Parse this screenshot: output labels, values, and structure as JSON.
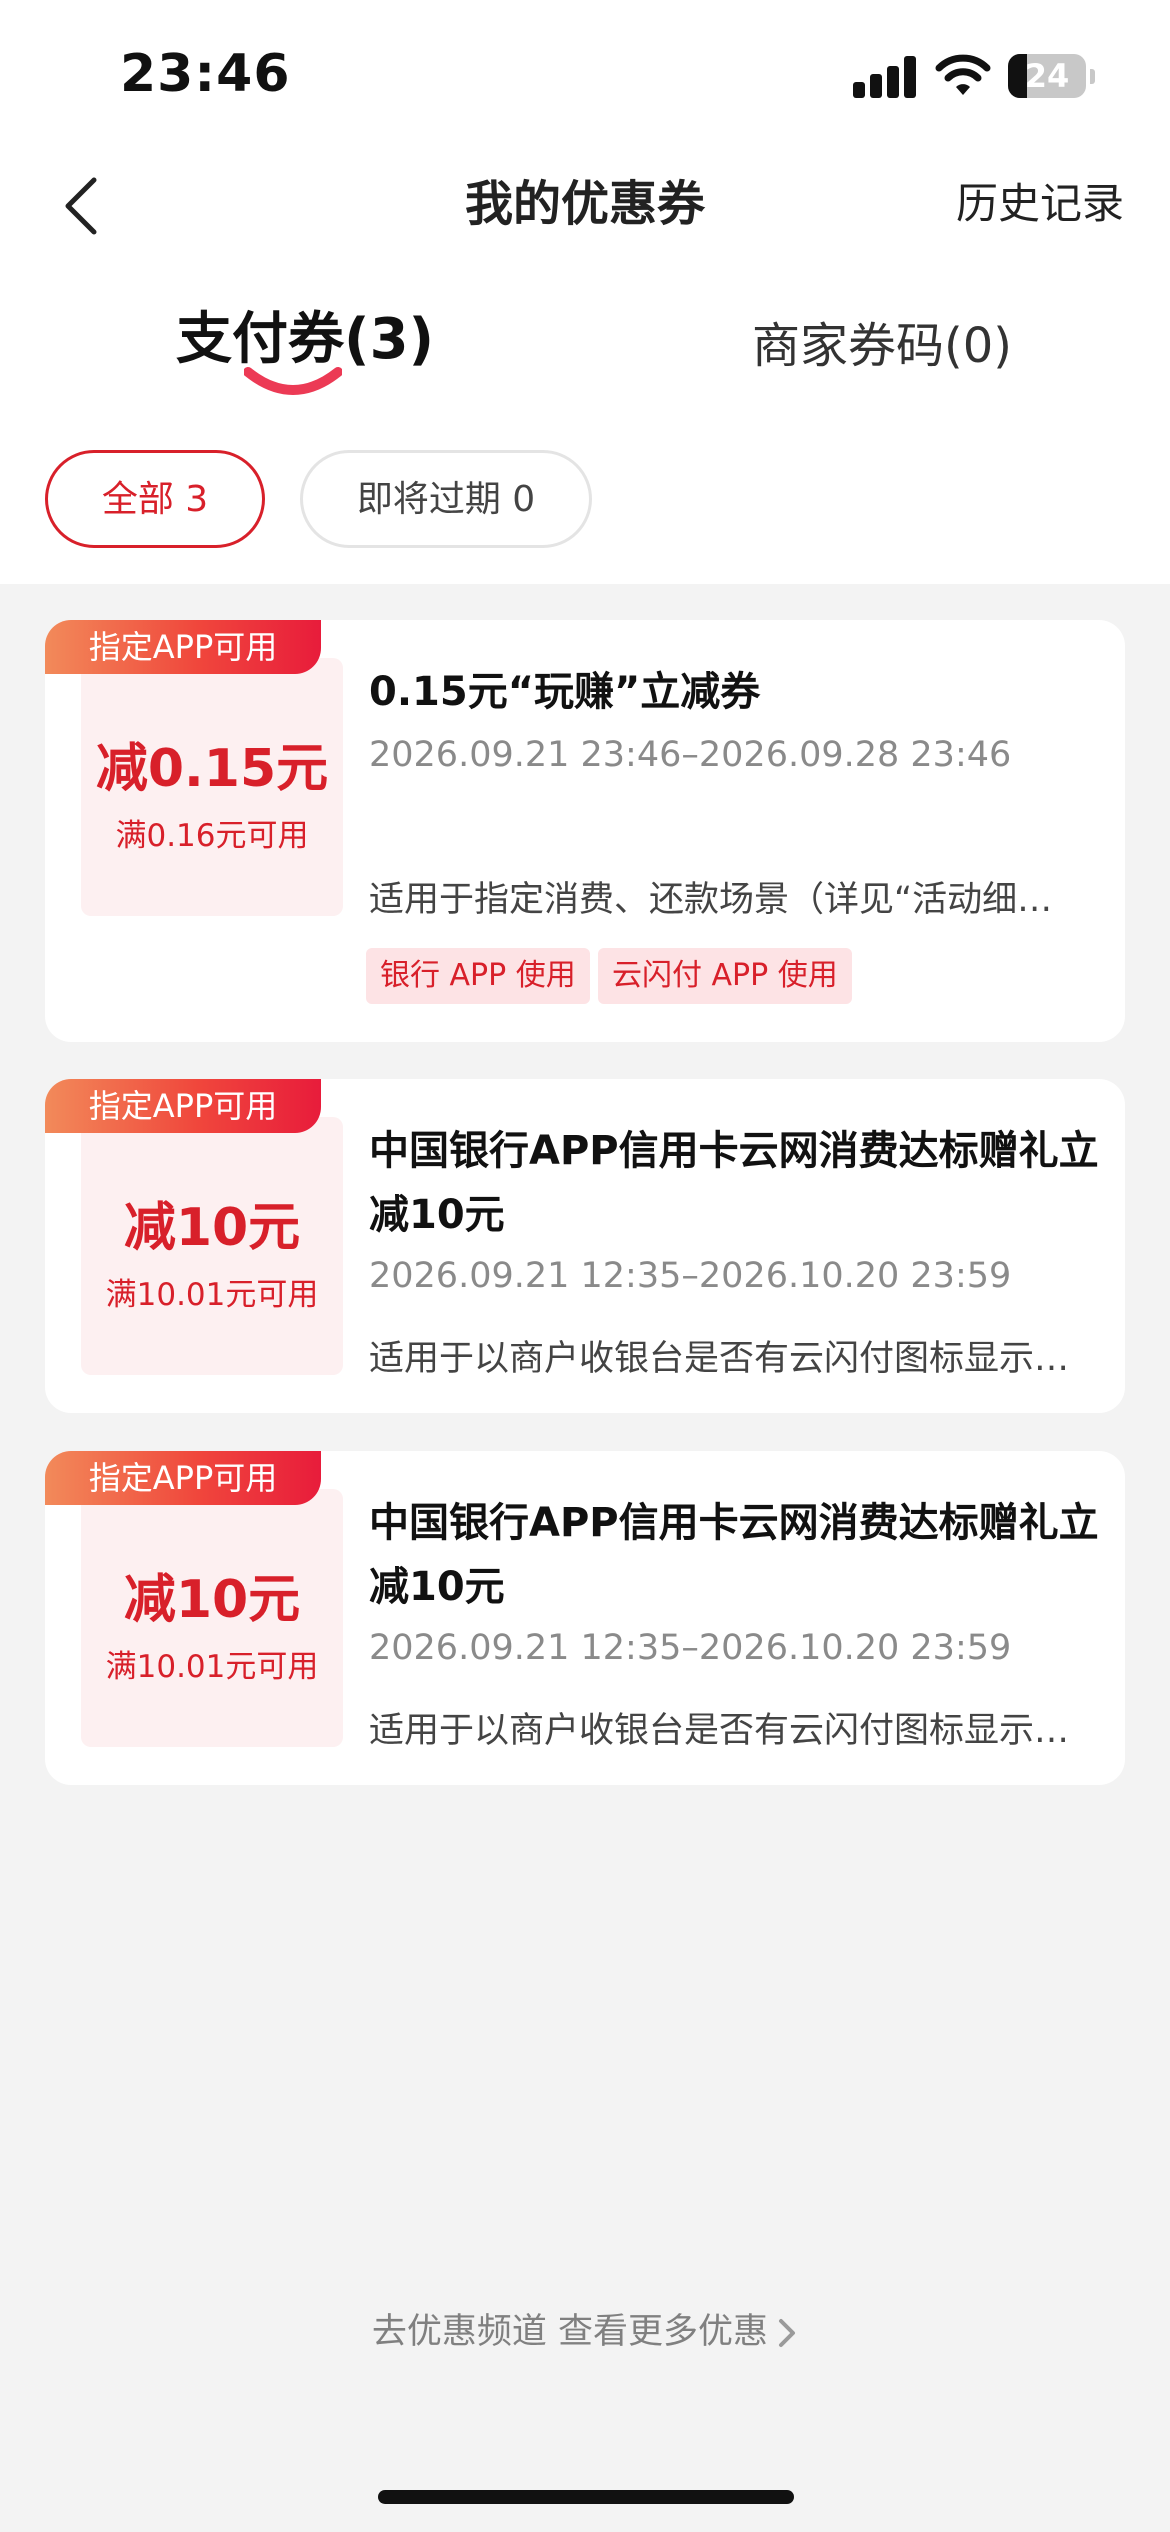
{
  "status_bar": {
    "time": "23:46",
    "battery": "24",
    "battery_level": 0.24
  },
  "nav": {
    "title": "我的优惠券",
    "history": "历史记录"
  },
  "tabs": [
    {
      "label": "支付券(3)",
      "active": true
    },
    {
      "label": "商家券码(0)",
      "active": false
    }
  ],
  "filters": [
    {
      "label": "全部 3",
      "active": true
    },
    {
      "label": "即将过期 0",
      "active": false
    }
  ],
  "coupons": [
    {
      "badge": "指定APP可用",
      "amount": "减0.15元",
      "threshold": "满0.16元可用",
      "title": "0.15元“玩赚”立减券",
      "date": "2026.09.21 23:46–2026.09.28 23:46",
      "desc": "适用于指定消费、还款场景（详见“活动细…",
      "tags": [
        "银行 APP 使用",
        "云闪付 APP 使用"
      ]
    },
    {
      "badge": "指定APP可用",
      "amount": "减10元",
      "threshold": "满10.01元可用",
      "title": "中国银行APP信用卡云网消费达标赠礼立减10元",
      "date": "2026.09.21 12:35–2026.10.20 23:59",
      "desc": "适用于以商户收银台是否有云闪付图标显示…"
    },
    {
      "badge": "指定APP可用",
      "amount": "减10元",
      "threshold": "满10.01元可用",
      "title": "中国银行APP信用卡云网消费达标赠礼立减10元",
      "date": "2026.09.21 12:35–2026.10.20 23:59",
      "desc": "适用于以商户收银台是否有云闪付图标显示…"
    }
  ],
  "footer": {
    "link": "去优惠频道 查看更多优惠"
  },
  "colors": {
    "accent": "#d8202a",
    "badge_gradient_start": "#f28a5a",
    "badge_gradient_end": "#e81c3b",
    "page_bg": "#f3f3f3",
    "coupon_left_bg": "#fdf0f1"
  }
}
